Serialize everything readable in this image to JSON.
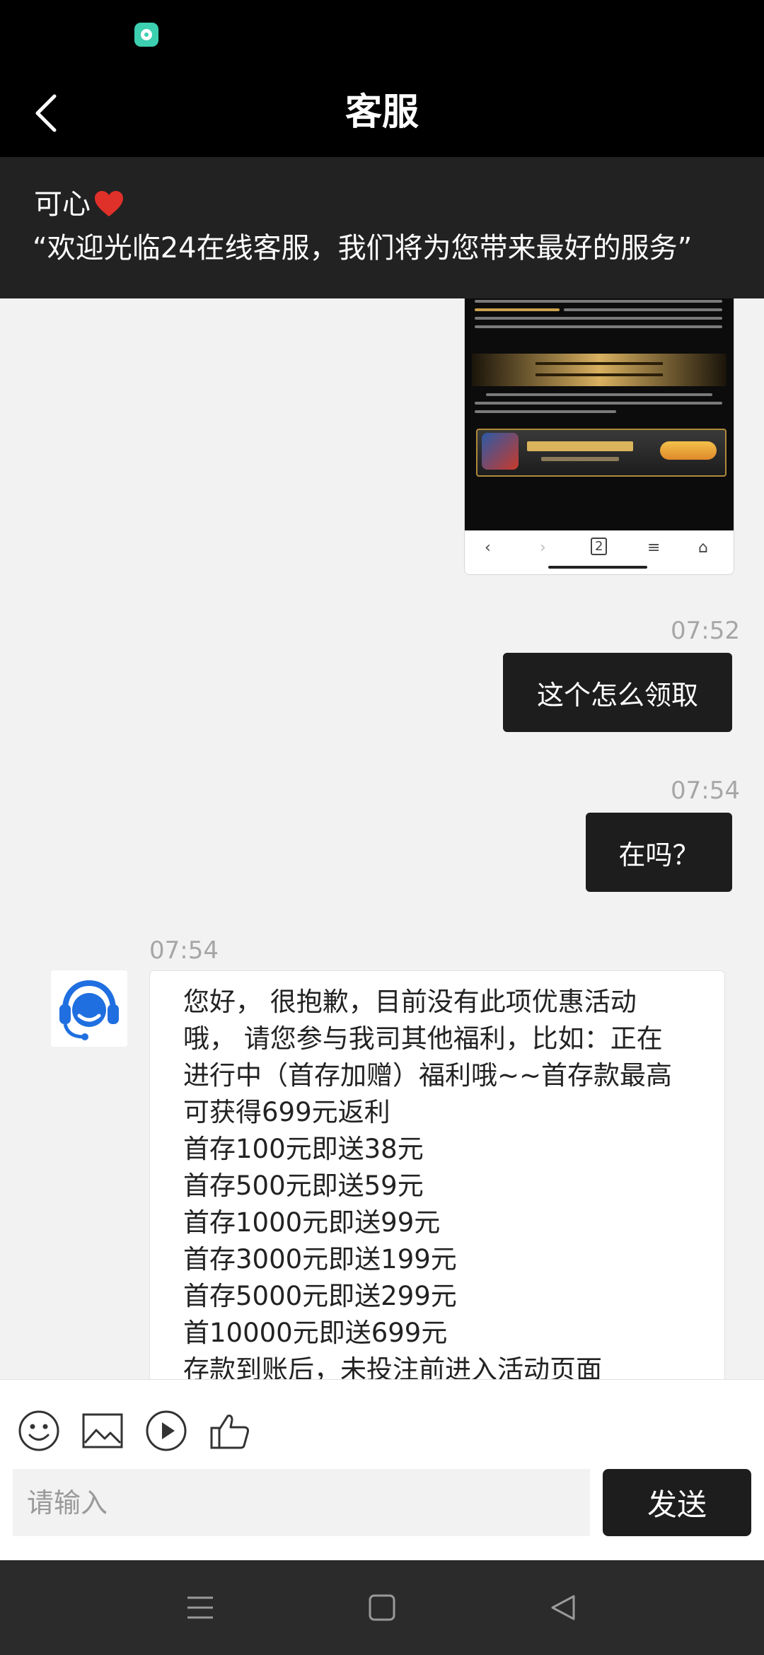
{
  "header": {
    "title": "客服"
  },
  "notice": {
    "agent_name": "可心",
    "welcome": "“欢迎光临24在线客服，我们将为您带来最好的服务”"
  },
  "messages": [
    {
      "sender": "user",
      "time": "07:52",
      "text": "这个怎么领取"
    },
    {
      "sender": "user",
      "time": "07:54",
      "text": "在吗？"
    },
    {
      "sender": "agent",
      "time": "07:54",
      "lines": [
        "您好， 很抱歉，目前没有此项优惠活动",
        "哦， 请您参与我司其他福利，比如：正在",
        "进行中（首存加赠）福利哦~~首存款最高",
        "可获得699元返利",
        "首存100元即送38元",
        "首存500元即送59元",
        "首存1000元即送99元",
        "首存3000元即送199元",
        "首存5000元即送299元",
        "首10000元即送699元",
        "存款到账后，未投注前进入活动页面"
      ]
    }
  ],
  "composer": {
    "placeholder": "请输入",
    "send_label": "发送"
  },
  "icons": {
    "toolbar": [
      "emoji-icon",
      "image-icon",
      "video-icon",
      "like-icon"
    ],
    "system_nav": [
      "menu-icon",
      "home-icon",
      "back-triangle-icon"
    ]
  },
  "colors": {
    "header_bg": "#000000",
    "banner_bg": "#222222",
    "bubble_out": "#1d1d1d",
    "avatar_blue": "#1f6fe0",
    "heart": "#e0302a"
  }
}
